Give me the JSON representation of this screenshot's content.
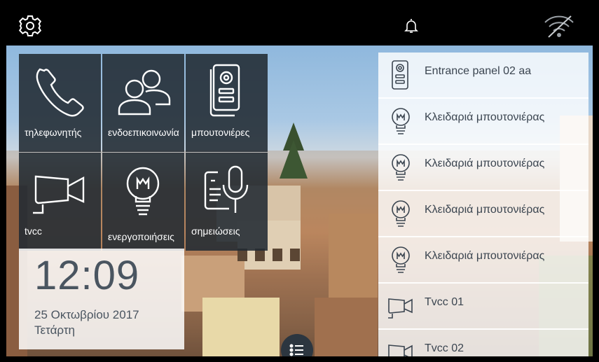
{
  "topbar": {
    "settings_icon": "gear-icon",
    "bell_icon": "bell-icon",
    "wifi_icon": "wifi-off-icon"
  },
  "tiles": [
    {
      "label": "τηλεφωνητής",
      "icon": "phone-icon"
    },
    {
      "label": "ενδοεπικοινωνία",
      "icon": "users-icon"
    },
    {
      "label": "μπουτονιέρες",
      "icon": "entry-panel-icon"
    },
    {
      "label": "tvcc",
      "icon": "camera-icon"
    },
    {
      "label": "ενεργοποιήσεις",
      "icon": "bulb-icon"
    },
    {
      "label": "σημειώσεις",
      "icon": "voice-note-icon"
    }
  ],
  "clock": {
    "time": "12:09",
    "date": "25 Οκτωβρίου 2017",
    "day": "Τετάρτη"
  },
  "list": {
    "items": [
      {
        "label": "Entrance panel 02 aa",
        "icon": "entry-panel-icon"
      },
      {
        "label": "Κλειδαριά μπουτονιέρας",
        "icon": "bulb-icon"
      },
      {
        "label": "Κλειδαριά μπουτονιέρας",
        "icon": "bulb-icon"
      },
      {
        "label": "Κλειδαριά μπουτονιέρας",
        "icon": "bulb-icon"
      },
      {
        "label": "Κλειδαριά μπουτονιέρας",
        "icon": "bulb-icon"
      },
      {
        "label": "Tvcc 01",
        "icon": "camera-icon"
      },
      {
        "label": "Tvcc 02",
        "icon": "camera-icon"
      }
    ]
  },
  "menu_button_icon": "menu-list-icon"
}
